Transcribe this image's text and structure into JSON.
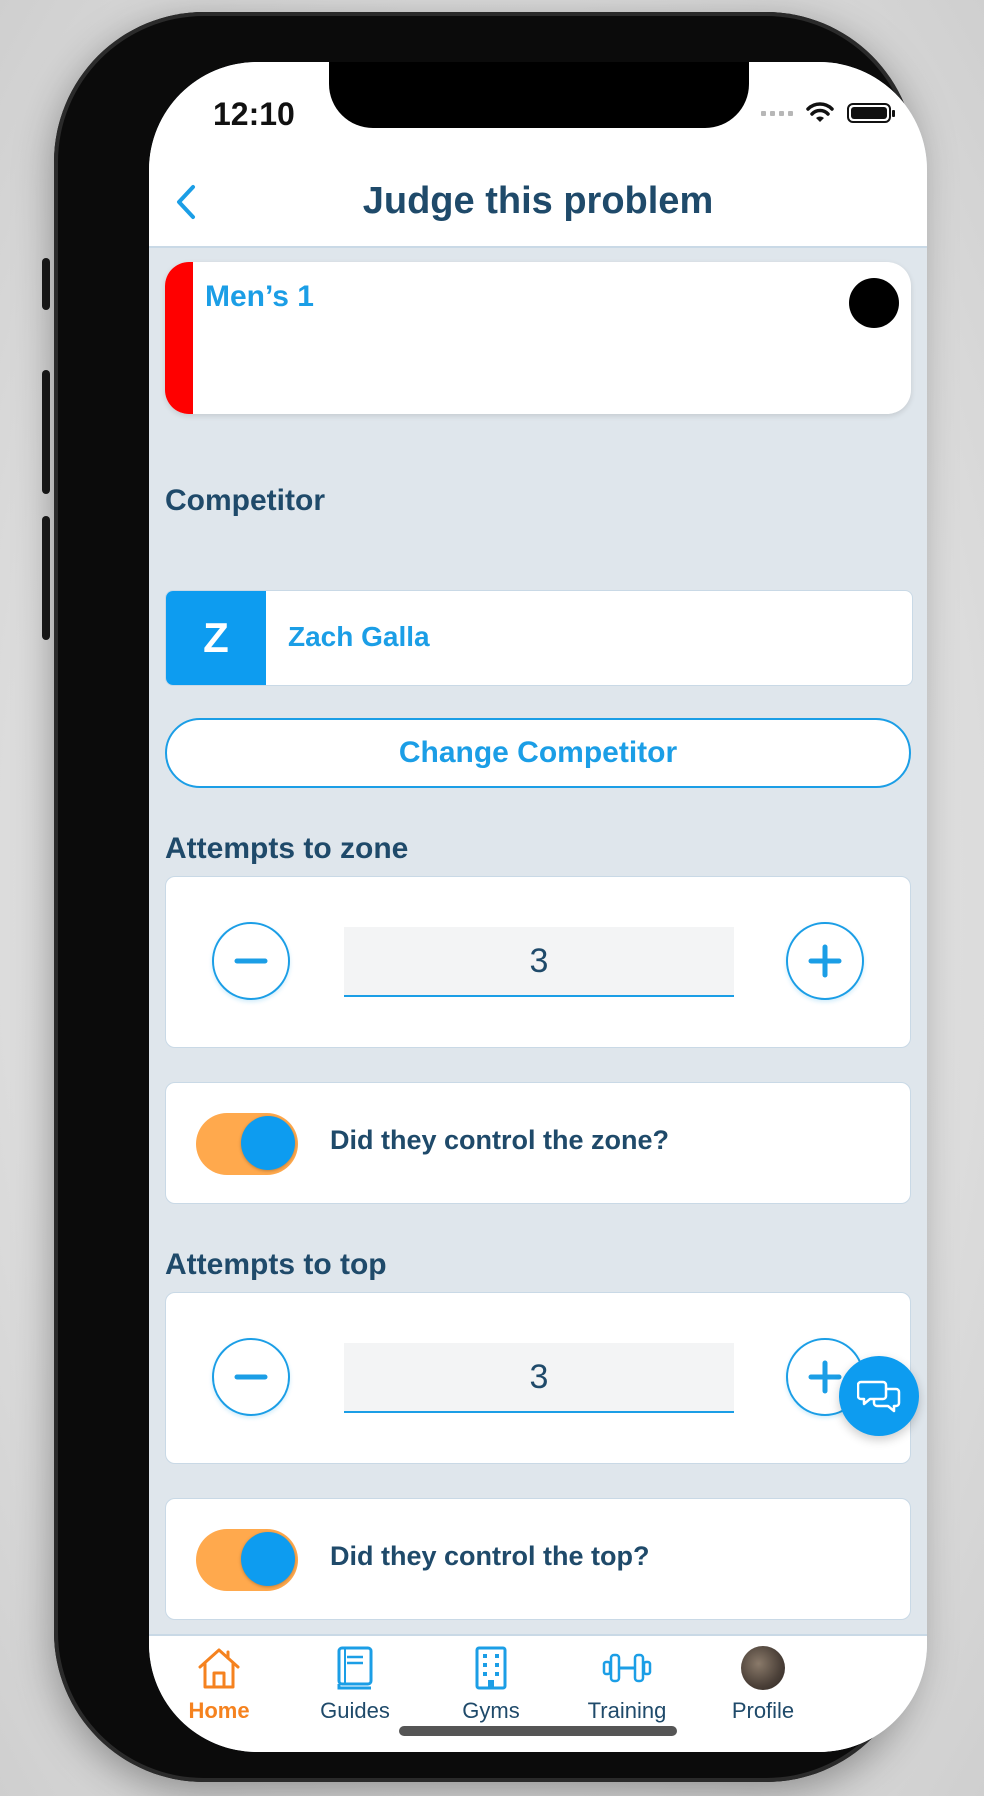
{
  "status_bar": {
    "time": "12:10"
  },
  "nav": {
    "title": "Judge this problem"
  },
  "problem": {
    "name": "Men’s 1",
    "stripe_color": "#ff0000",
    "hold_color": "#000000"
  },
  "competitor": {
    "section_label": "Competitor",
    "initial": "Z",
    "name": "Zach Galla",
    "change_button": "Change Competitor"
  },
  "zone": {
    "section_label": "Attempts to zone",
    "attempts_value": "3",
    "control_question": "Did they control the zone?",
    "control_checked": true
  },
  "top": {
    "section_label": "Attempts to top",
    "attempts_value": "3",
    "control_question": "Did they control the top?",
    "control_checked": true
  },
  "tabbar": {
    "tabs": [
      {
        "label": "Home",
        "icon": "home-icon",
        "active": true
      },
      {
        "label": "Guides",
        "icon": "book-icon",
        "active": false
      },
      {
        "label": "Gyms",
        "icon": "building-icon",
        "active": false
      },
      {
        "label": "Training",
        "icon": "dumbbell-icon",
        "active": false
      },
      {
        "label": "Profile",
        "icon": "avatar",
        "active": false
      }
    ]
  },
  "colors": {
    "accent_blue": "#1b9ee6",
    "accent_orange": "#f5821f",
    "toggle_track": "#ffa94d",
    "heading": "#1f4a6a",
    "background": "#dfe6ec"
  }
}
